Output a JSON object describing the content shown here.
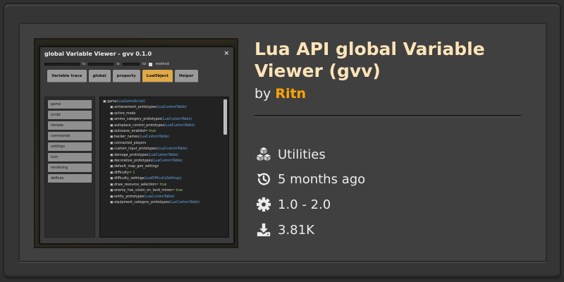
{
  "mod": {
    "title": "Lua API global Variable Viewer (gvv)",
    "by_label": "by",
    "author": "Ritn",
    "category": "Utilities",
    "updated": "5 months ago",
    "versions": "1.0 - 2.0",
    "downloads": "3.81K"
  },
  "thumbnail": {
    "window_title": "global Variable Viewer - gvv 0.1.0",
    "close_glyph": "×",
    "toolbar": [
      "lv",
      "lv",
      "lvl",
      "method"
    ],
    "tabs": [
      {
        "label": "Variable trace",
        "active": false
      },
      {
        "label": "global",
        "active": false
      },
      {
        "label": "property",
        "active": false
      },
      {
        "label": "LuaObject",
        "active": true
      },
      {
        "label": "Helper",
        "active": false
      }
    ],
    "sidebar": [
      "game",
      "script",
      "remote",
      "commands",
      "settings",
      "icon",
      "rendering",
      "defines"
    ],
    "tree": [
      {
        "name": "game",
        "type": "(LuaGameScript)"
      },
      {
        "name": "achievement_prototypes",
        "type": "(LuaCustomTable)"
      },
      {
        "name": "active_mods",
        "type": ""
      },
      {
        "name": "ammo_category_prototypes",
        "type": "(LuaCustomTable)"
      },
      {
        "name": "autoplace_control_prototypes",
        "type": "(LuaCustomTable)"
      },
      {
        "name": "autosave_enabled",
        "type": "= true"
      },
      {
        "name": "backer_names",
        "type": "(LuaCustomTable)"
      },
      {
        "name": "connected_players",
        "type": ""
      },
      {
        "name": "custom_input_prototypes",
        "type": "(LuaCustomTable)"
      },
      {
        "name": "damage_prototypes",
        "type": "(LuaCustomTable)"
      },
      {
        "name": "decorative_prototypes",
        "type": "(LuaCustomTable)"
      },
      {
        "name": "default_map_gen_settings",
        "type": ""
      },
      {
        "name": "difficulty",
        "type": "= 1"
      },
      {
        "name": "difficulty_settings",
        "type": "(LuaDifficultySettings)"
      },
      {
        "name": "draw_resource_selection",
        "type": "= true"
      },
      {
        "name": "enemy_has_vision_on_land_mines",
        "type": "= true"
      },
      {
        "name": "entity_prototypes",
        "type": "(LuaCustomTable)"
      },
      {
        "name": "equipment_category_prototypes",
        "type": "(LuaCustomTable)"
      }
    ]
  },
  "colors": {
    "title": "#fde4b8",
    "author": "#ffa500",
    "text": "#ececec",
    "card": "#414040"
  },
  "icons": {
    "category": "cubes-icon",
    "updated": "history-icon",
    "versions": "gear-icon",
    "downloads": "download-icon"
  }
}
